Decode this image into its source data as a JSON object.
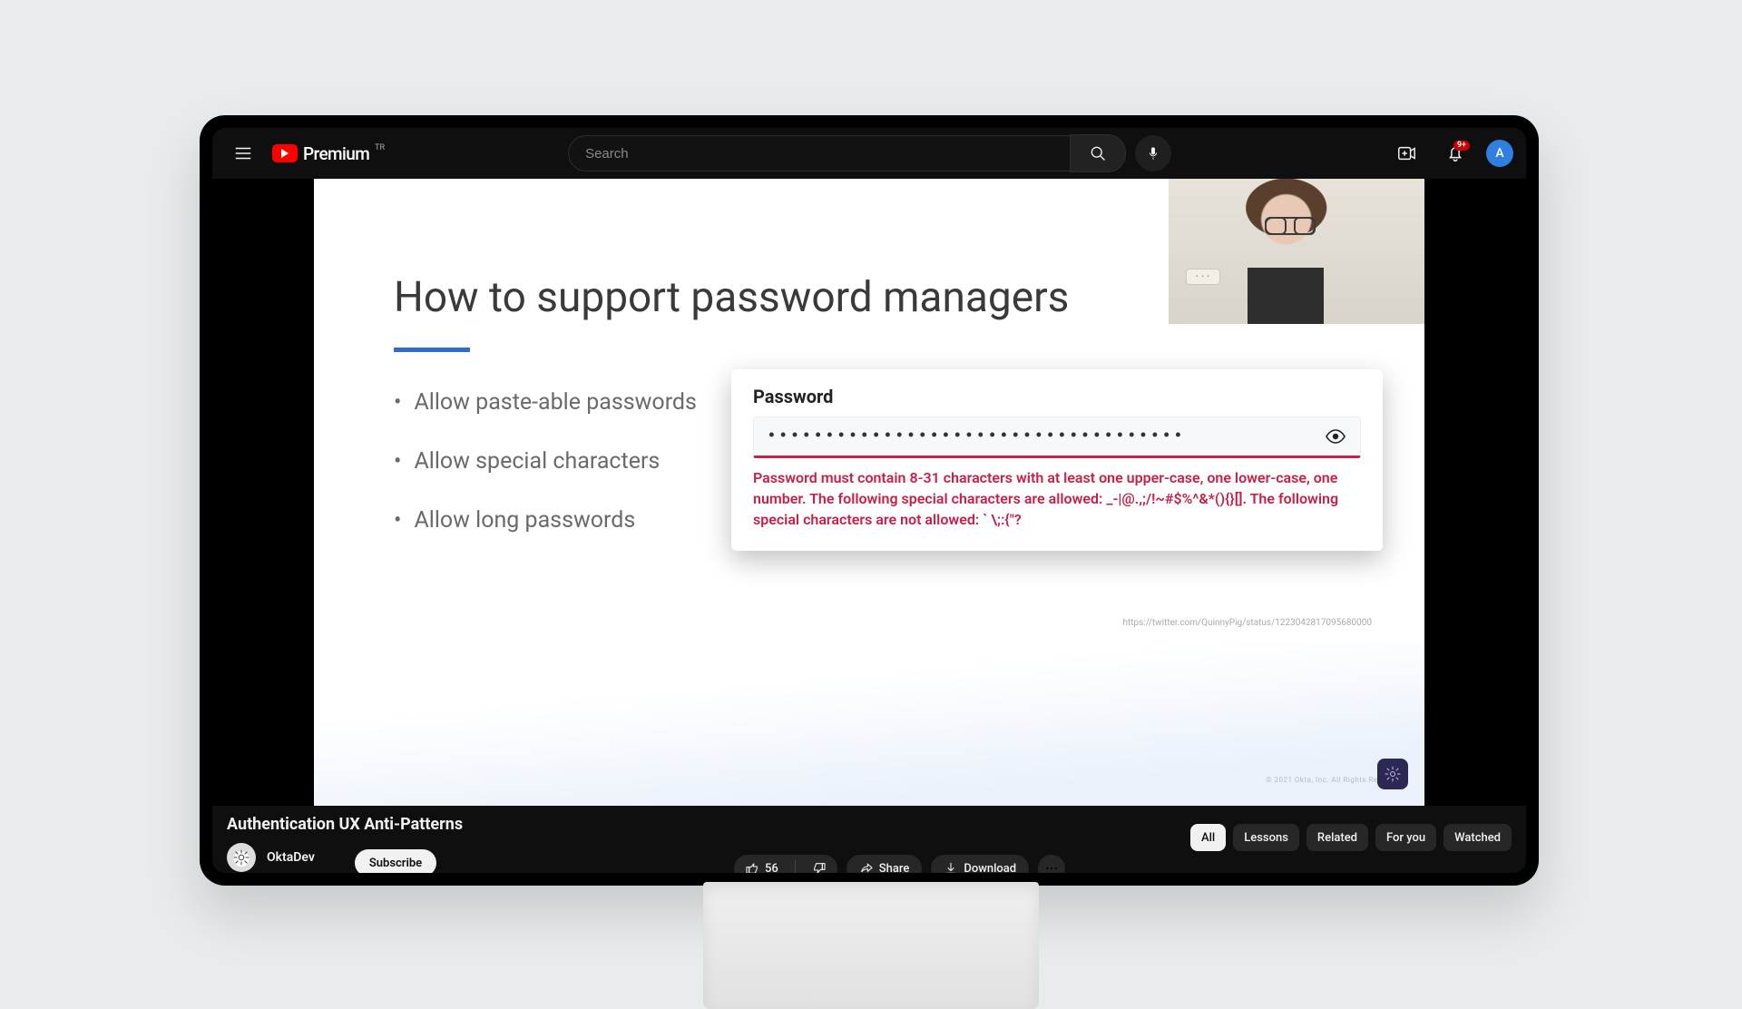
{
  "topbar": {
    "brand_text": "Premium",
    "country_code": "TR",
    "search_placeholder": "Search",
    "notification_count": "9+",
    "avatar_initial": "A"
  },
  "slide": {
    "title": "How to support password managers",
    "bullets": [
      "Allow paste-able passwords",
      "Allow special characters",
      "Allow long passwords"
    ],
    "password_label": "Password",
    "password_masked": "••••••••••••••••••••••••••••••••••••",
    "password_error": "Password must contain 8-31 characters with at least one upper-case, one lower-case, one number. The following special characters are allowed: _-|@.,;/!~#$%^&*(){}[]. The following special characters are not allowed: ` \\;:{\"?",
    "attribution": "https://twitter.com/QuinnyPig/status/1223042817095680000",
    "copyright": "© 2021 Okta, Inc. All Rights Reserved.",
    "cam_switch_label": "• • •"
  },
  "video": {
    "title": "Authentication UX Anti-Patterns",
    "channel": "OktaDev",
    "subscribe_label": "Subscribe",
    "like_count": "56",
    "share_label": "Share",
    "download_label": "Download"
  },
  "chips": [
    {
      "label": "All",
      "active": true
    },
    {
      "label": "Lessons",
      "active": false
    },
    {
      "label": "Related",
      "active": false
    },
    {
      "label": "For you",
      "active": false
    },
    {
      "label": "Watched",
      "active": false
    }
  ]
}
